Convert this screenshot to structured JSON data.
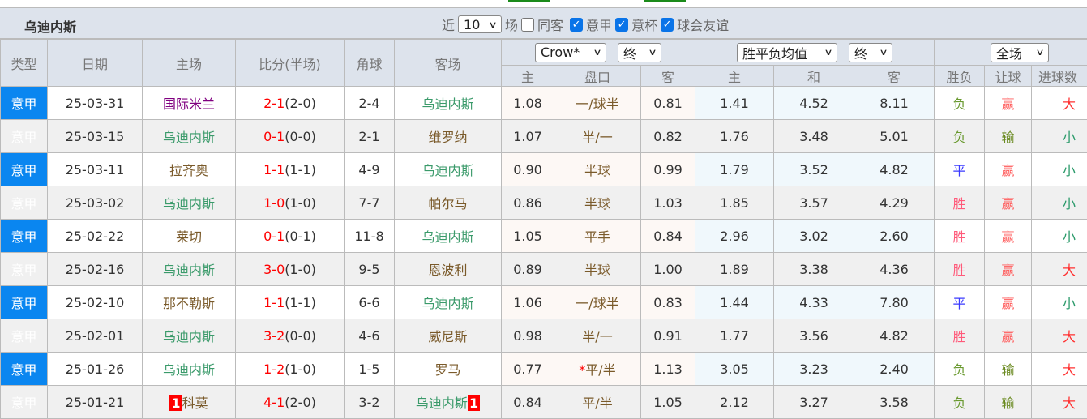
{
  "team": "乌迪内斯",
  "filters": {
    "recent_label": "近",
    "count": "10",
    "games_label": "场",
    "same_venue": {
      "label": "同客",
      "checked": false
    },
    "leagues": [
      {
        "label": "意甲",
        "checked": true
      },
      {
        "label": "意杯",
        "checked": true
      },
      {
        "label": "球会友谊",
        "checked": true
      }
    ]
  },
  "headers": {
    "type": "类型",
    "date": "日期",
    "home": "主场",
    "score": "比分(半场)",
    "corners": "角球",
    "away": "客场",
    "asian_company": "Crow*",
    "asian_stage": "终",
    "euro_company": "胜平负均值",
    "euro_stage": "终",
    "period": "全场",
    "ah_home": "主",
    "ah_line": "盘口",
    "ah_away": "客",
    "eu_home": "主",
    "eu_draw": "和",
    "eu_away": "客",
    "result": "胜负",
    "handicap": "让球",
    "goals": "进球数"
  },
  "colors": {
    "type_bg": "#0a86f0",
    "score": "#ff0000",
    "udinese": "#3a9a6a"
  },
  "rows": [
    {
      "type": "意甲",
      "date": "25-03-31",
      "home": "国际米兰",
      "score": "2-1",
      "half": "(2-0)",
      "corners": "2-4",
      "away": "乌迪内斯",
      "ah_h": "1.08",
      "line": "一/球半",
      "ah_a": "0.81",
      "eu_h": "1.41",
      "eu_d": "4.52",
      "eu_a": "8.11",
      "res": "负",
      "hc": "赢",
      "goals": "大"
    },
    {
      "type": "意甲",
      "date": "25-03-15",
      "home": "乌迪内斯",
      "score": "0-1",
      "half": "(0-0)",
      "corners": "2-1",
      "away": "维罗纳",
      "ah_h": "1.07",
      "line": "半/一",
      "ah_a": "0.82",
      "eu_h": "1.76",
      "eu_d": "3.48",
      "eu_a": "5.01",
      "res": "负",
      "hc": "输",
      "goals": "小"
    },
    {
      "type": "意甲",
      "date": "25-03-11",
      "home": "拉齐奥",
      "score": "1-1",
      "half": "(1-1)",
      "corners": "4-9",
      "away": "乌迪内斯",
      "ah_h": "0.90",
      "line": "半球",
      "ah_a": "0.99",
      "eu_h": "1.79",
      "eu_d": "3.52",
      "eu_a": "4.82",
      "res": "平",
      "hc": "赢",
      "goals": "小"
    },
    {
      "type": "意甲",
      "date": "25-03-02",
      "home": "乌迪内斯",
      "score": "1-0",
      "half": "(1-0)",
      "corners": "7-7",
      "away": "帕尔马",
      "ah_h": "0.86",
      "line": "半球",
      "ah_a": "1.03",
      "eu_h": "1.85",
      "eu_d": "3.57",
      "eu_a": "4.29",
      "res": "胜",
      "hc": "赢",
      "goals": "小"
    },
    {
      "type": "意甲",
      "date": "25-02-22",
      "home": "莱切",
      "score": "0-1",
      "half": "(0-1)",
      "corners": "11-8",
      "away": "乌迪内斯",
      "ah_h": "1.05",
      "line": "平手",
      "ah_a": "0.84",
      "eu_h": "2.96",
      "eu_d": "3.02",
      "eu_a": "2.60",
      "res": "胜",
      "hc": "赢",
      "goals": "小"
    },
    {
      "type": "意甲",
      "date": "25-02-16",
      "home": "乌迪内斯",
      "score": "3-0",
      "half": "(1-0)",
      "corners": "9-5",
      "away": "恩波利",
      "ah_h": "0.89",
      "line": "半球",
      "ah_a": "1.00",
      "eu_h": "1.89",
      "eu_d": "3.38",
      "eu_a": "4.36",
      "res": "胜",
      "hc": "赢",
      "goals": "大"
    },
    {
      "type": "意甲",
      "date": "25-02-10",
      "home": "那不勒斯",
      "score": "1-1",
      "half": "(1-1)",
      "corners": "6-6",
      "away": "乌迪内斯",
      "ah_h": "1.06",
      "line": "一/球半",
      "ah_a": "0.83",
      "eu_h": "1.44",
      "eu_d": "4.33",
      "eu_a": "7.80",
      "res": "平",
      "hc": "赢",
      "goals": "小"
    },
    {
      "type": "意甲",
      "date": "25-02-01",
      "home": "乌迪内斯",
      "score": "3-2",
      "half": "(0-0)",
      "corners": "4-6",
      "away": "威尼斯",
      "ah_h": "0.98",
      "line": "半/一",
      "ah_a": "0.91",
      "eu_h": "1.77",
      "eu_d": "3.56",
      "eu_a": "4.82",
      "res": "胜",
      "hc": "赢",
      "goals": "大"
    },
    {
      "type": "意甲",
      "date": "25-01-26",
      "home": "乌迪内斯",
      "score": "1-2",
      "half": "(1-0)",
      "corners": "1-5",
      "away": "罗马",
      "ah_h": "0.77",
      "line_mark": "*",
      "line": "平/半",
      "ah_a": "1.13",
      "eu_h": "3.05",
      "eu_d": "3.23",
      "eu_a": "2.40",
      "res": "负",
      "hc": "输",
      "goals": "大"
    },
    {
      "type": "意甲",
      "date": "25-01-21",
      "home": "科莫",
      "home_badge": "1",
      "score": "4-1",
      "half": "(2-0)",
      "corners": "3-2",
      "away": "乌迪内斯",
      "away_badge": "1",
      "ah_h": "0.84",
      "line": "平/半",
      "ah_a": "1.05",
      "eu_h": "2.12",
      "eu_d": "3.27",
      "eu_a": "3.58",
      "res": "负",
      "hc": "输",
      "goals": "大"
    }
  ]
}
